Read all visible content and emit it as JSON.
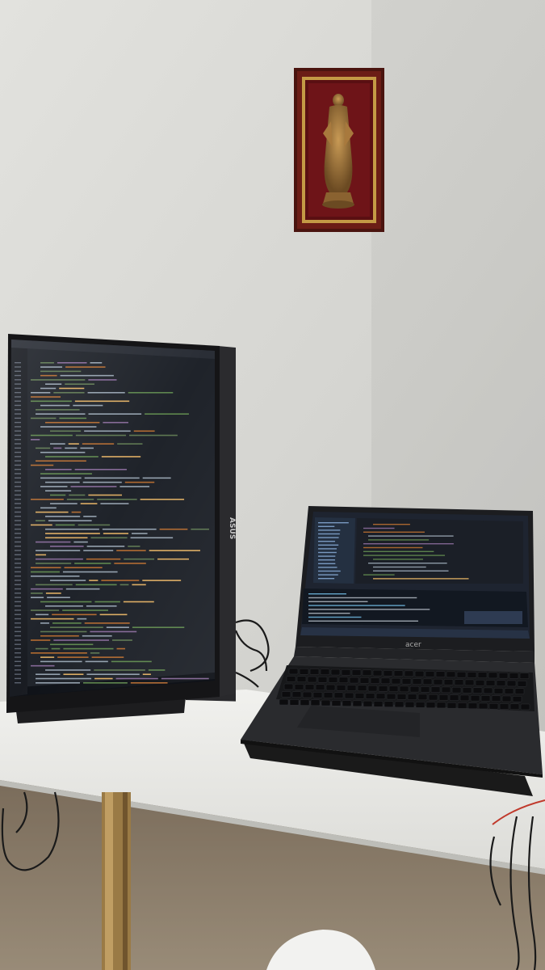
{
  "monitor": {
    "brand": "ASUS"
  },
  "laptop": {
    "brand": "acer"
  },
  "colors": {
    "wall": "#d6d6d2",
    "desk": "#e9e9e6",
    "ide_bg": "#1f232a",
    "code_keyword": "#cc7832",
    "code_string": "#6a8759",
    "code_function": "#ffc66d",
    "code_comment": "#6a9955",
    "frame_wood": "#5a1a14"
  }
}
